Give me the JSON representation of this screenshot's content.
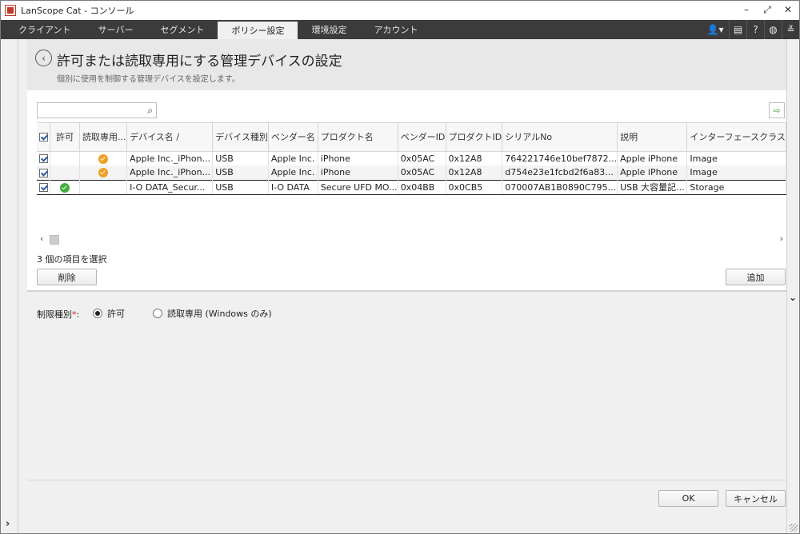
{
  "window": {
    "title": "LanScope Cat - コンソール",
    "controls": [
      "–",
      "⤢",
      "✕"
    ]
  },
  "tabs": [
    {
      "label": "クライアント",
      "active": false
    },
    {
      "label": "サーバー",
      "active": false
    },
    {
      "label": "セグメント",
      "active": false
    },
    {
      "label": "ポリシー設定",
      "active": true
    },
    {
      "label": "環境設定",
      "active": false
    },
    {
      "label": "アカウント",
      "active": false
    }
  ],
  "toolbar_icons": [
    "user-icon",
    "monitor-icon",
    "help-icon",
    "globe-icon",
    "menu-collapse-icon"
  ],
  "header": {
    "title": "許可または読取専用にする管理デバイスの設定",
    "subtitle": "個別に使用を制御する管理デバイスを設定します。"
  },
  "search": {
    "value": "",
    "placeholder": ""
  },
  "table": {
    "columns": [
      "",
      "許可",
      "読取専用...",
      "デバイス名",
      "デバイス種別",
      "ベンダー名",
      "プロダクト名",
      "ベンダーID",
      "プロダクトID",
      "シリアルNo",
      "説明",
      "インターフェースクラス"
    ],
    "header_checked": true,
    "sort_indicator": "/",
    "rows": [
      {
        "checked": true,
        "permit": false,
        "readonly": true,
        "device_name": "Apple Inc._iPhon...",
        "device_type": "USB",
        "vendor": "Apple Inc.",
        "product": "iPhone",
        "vendor_id": "0x05AC",
        "product_id": "0x12A8",
        "serial": "764221746e10bef7872...",
        "description": "Apple iPhone",
        "iface": "Image"
      },
      {
        "checked": true,
        "permit": false,
        "readonly": true,
        "device_name": "Apple Inc._iPhon...",
        "device_type": "USB",
        "vendor": "Apple Inc.",
        "product": "iPhone",
        "vendor_id": "0x05AC",
        "product_id": "0x12A8",
        "serial": "d754e23e1fcbd2f6a83...",
        "description": "Apple iPhone",
        "iface": "Image"
      },
      {
        "checked": true,
        "permit": true,
        "readonly": false,
        "device_name": "I-O DATA_Secur...",
        "device_type": "USB",
        "vendor": "I-O DATA",
        "product": "Secure UFD MO...",
        "vendor_id": "0x04BB",
        "product_id": "0x0CB5",
        "serial": "070007AB1B0890C795...",
        "description": "USB 大容量記...",
        "iface": "Storage"
      }
    ]
  },
  "selection_text": "3 個の項目を選択",
  "buttons": {
    "delete": "削除",
    "add": "追加",
    "ok": "OK",
    "cancel": "キャンセル"
  },
  "restriction": {
    "label": "制限種別",
    "required_mark": "*",
    "colon": ":",
    "options": [
      {
        "label": "許可",
        "selected": true,
        "enabled": true
      },
      {
        "label": "読取専用 (Windows のみ)",
        "selected": false,
        "enabled": true
      }
    ]
  },
  "colors": {
    "tabbar": "#3b3b3b",
    "readonly_dot": "#f0a020",
    "permit_dot": "#3fae3f"
  }
}
